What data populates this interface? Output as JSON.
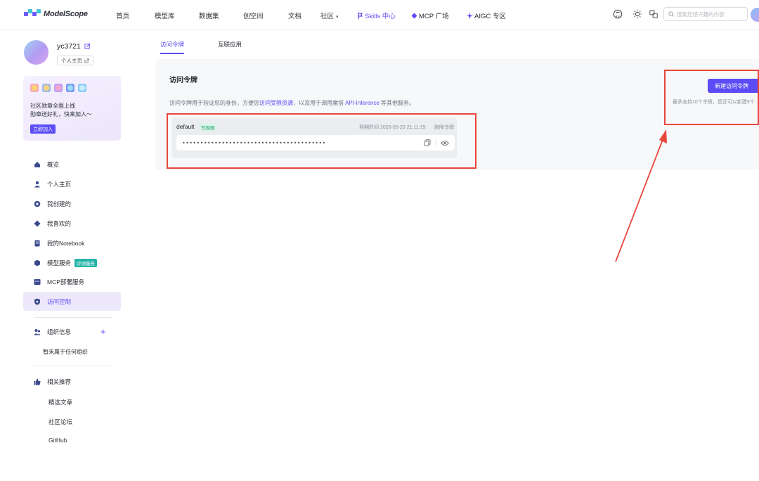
{
  "brand": {
    "name": "ModelScope"
  },
  "nav": {
    "items": [
      "首页",
      "模型库",
      "数据集",
      "创空间",
      "文档",
      "社区",
      "Skills 中心",
      "MCP 广场",
      "AIGC 专区"
    ],
    "community_caret": "▾"
  },
  "search": {
    "placeholder": "搜索您感兴趣的内容"
  },
  "user": {
    "name": "yc3721",
    "profile_link": "个人主页"
  },
  "badge_card": {
    "line1": "社区勋章全面上线",
    "line2": "勋章送好礼，快来加入～",
    "join_label": "立即加入"
  },
  "sidebar": {
    "items": [
      {
        "label": "概览",
        "icon": "home-icon"
      },
      {
        "label": "个人主页",
        "icon": "user-icon"
      },
      {
        "label": "我创建的",
        "icon": "create-icon"
      },
      {
        "label": "我喜欢的",
        "icon": "diamond-icon"
      },
      {
        "label": "我的Notebook",
        "icon": "notebook-icon"
      },
      {
        "label": "模型服务",
        "icon": "cube-icon",
        "tag": "评测服务"
      },
      {
        "label": "MCP部署服务",
        "icon": "server-icon"
      },
      {
        "label": "访问控制",
        "icon": "shield-icon",
        "active": true
      }
    ],
    "org_title": "组织信息",
    "org_empty": "暂未属于任何组织",
    "recommend_title": "相关推荐",
    "recommend_links": [
      "精选文章",
      "社区论坛",
      "GitHub"
    ]
  },
  "tabs": [
    {
      "label": "访问令牌",
      "active": true
    },
    {
      "label": "互联应用",
      "active": false
    }
  ],
  "panel": {
    "title": "访问令牌",
    "desc_prefix": "访问令牌用于验证您的身份，方便您",
    "desc_link1": "访问受限资源",
    "desc_mid": "，以及用于调用魔搭",
    "desc_link2": "API-Inference",
    "desc_suffix": "等其他服务。",
    "new_button": "新建访问令牌",
    "limit_text": "最多支持10个令牌，您还可以新建9个"
  },
  "token": {
    "name": "default",
    "permission": "写权限",
    "expiry": "到期时间 2026-05-20 21:11:19",
    "delete_label": "删除令牌",
    "masked_value": "••••••••••••••••••••••••••••••••••••••••"
  },
  "colors": {
    "accent": "#5b4cf5",
    "annotation_red": "#e8473c"
  }
}
